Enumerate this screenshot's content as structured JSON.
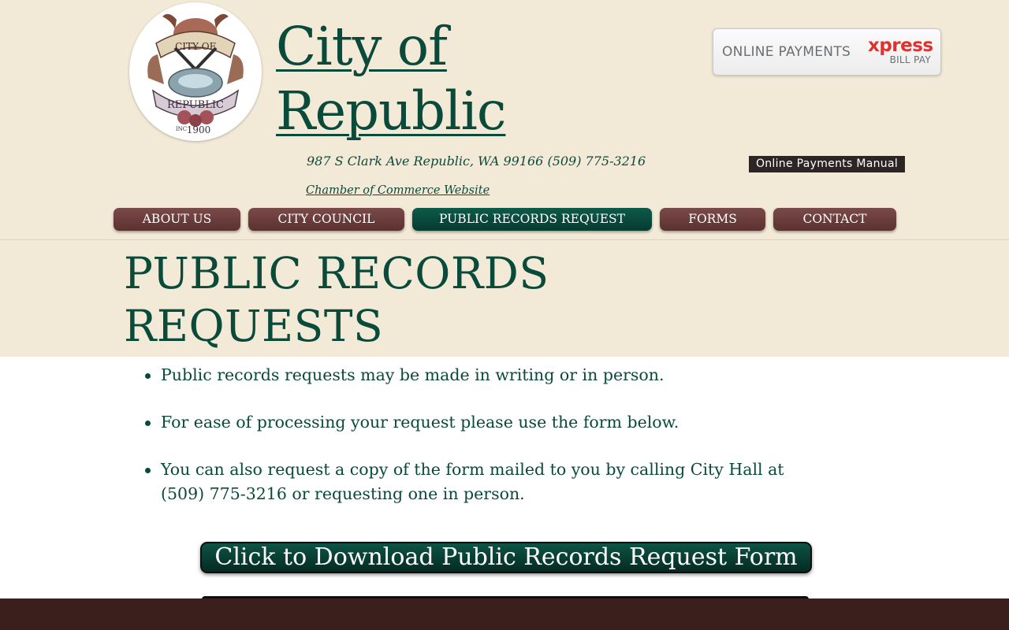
{
  "site": {
    "title": "City of Republic",
    "address": "987 S Clark Ave Republic, WA 99166 (509) 775-3216",
    "chamber_link": "Chamber of Commerce Website "
  },
  "seal": {
    "text_top": "CITY OF",
    "text_bottom": "REPUBLIC",
    "text_inc": "INC",
    "text_year": "1900"
  },
  "payments": {
    "main_label": "ONLINE PAYMENTS",
    "brand": "xpress",
    "sub_label": "BILL PAY",
    "manual_label": "Online Payments Manual"
  },
  "nav": {
    "items": [
      {
        "label": "ABOUT US"
      },
      {
        "label": "CITY COUNCIL"
      },
      {
        "label": "PUBLIC RECORDS REQUEST"
      },
      {
        "label": "FORMS"
      },
      {
        "label": "CONTACT"
      }
    ]
  },
  "page": {
    "title_line1": "PUBLIC RECORDS",
    "title_line2": "REQUESTS",
    "bullets": [
      "Public records requests may be made in writing or in person.",
      "For ease of processing your request please use the form below.",
      "You can also request a copy of the form mailed to you by calling City Hall at (509) 775-3216 or requesting one in person."
    ],
    "download_label": "Click to Download Public Records Request Form"
  },
  "colors": {
    "brand_green": "#0a4a3b",
    "nav_brown": "#6b3c3a",
    "header_cream": "#f2ead7",
    "footer_brown": "#3a1f1c",
    "xpress_red": "#e0312e"
  }
}
